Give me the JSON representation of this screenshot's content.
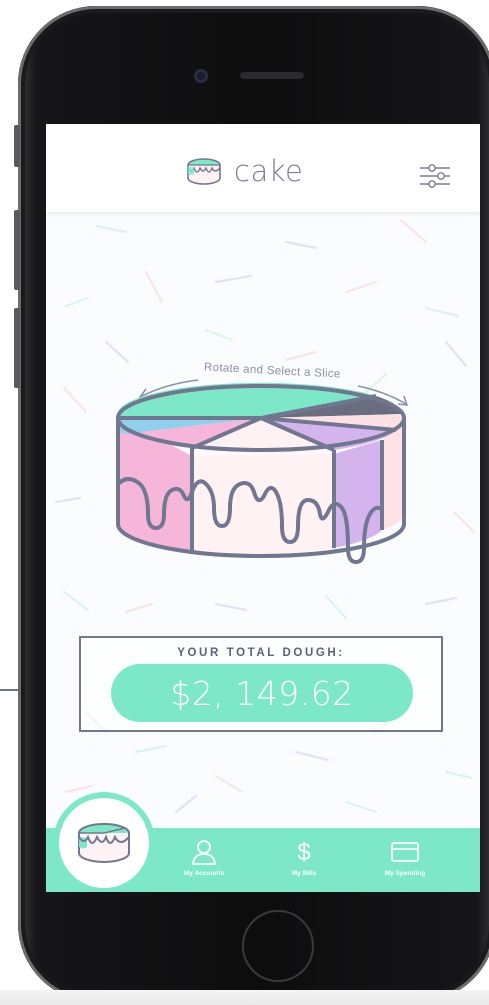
{
  "app": {
    "brand_name": "cake",
    "brand_icon": "cake-logo-icon",
    "filter_icon": "sliders-icon"
  },
  "colors": {
    "mint": "#7de8c8",
    "slate": "#717790",
    "pink": "#f5b6d9",
    "lavender": "#d4b4ec",
    "blue": "#8fd0ec",
    "peach": "#fde1e4",
    "cream": "#fff2f2",
    "charcoal": "#6a6d80"
  },
  "cake": {
    "rotate_label": "Rotate and Select a Slice",
    "left_arrow_icon": "curved-arrow-left-icon",
    "right_arrow_icon": "curved-arrow-right-icon"
  },
  "total": {
    "label": "YOUR TOTAL DOUGH:",
    "amount": "$2, 149.62"
  },
  "tabbar": {
    "home_icon": "cake-home-icon",
    "tabs": [
      {
        "label": "My Accounts",
        "icon": "user-icon"
      },
      {
        "label": "My Bills",
        "icon": "dollar-icon"
      },
      {
        "label": "My Spending",
        "icon": "credit-card-icon"
      }
    ]
  }
}
